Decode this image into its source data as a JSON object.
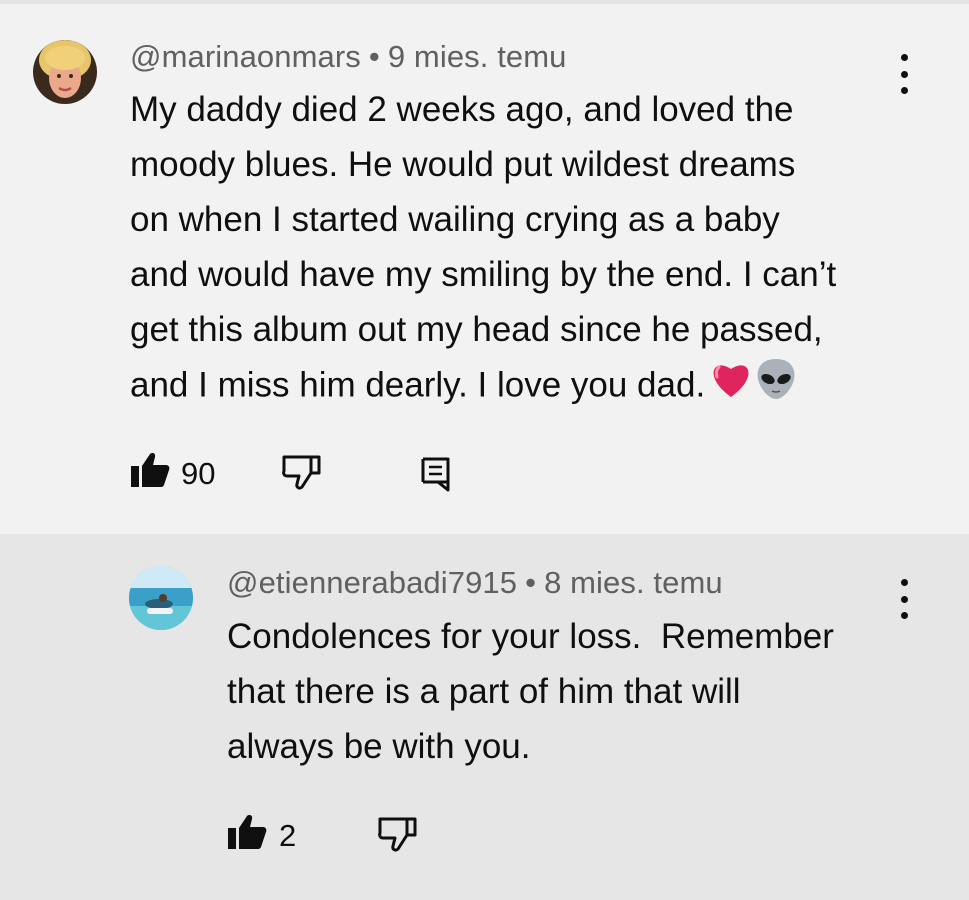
{
  "comment": {
    "username": "@marinaonmars",
    "separator": "•",
    "timestamp": "9 mies. temu",
    "text_lines": [
      "My daddy died 2 weeks ago, and loved the",
      "moody blues. He would put wildest dreams",
      "on when I started wailing crying as a baby",
      "and would have my smiling by the end. I can’t",
      "get this album out my head since he passed,",
      "and I miss him dearly. I love you dad."
    ],
    "emojis": [
      "heart-emoji",
      "alien-emoji"
    ],
    "likes": "90"
  },
  "reply": {
    "username": "@etiennerabadi7915",
    "separator": "•",
    "timestamp": "8 mies. temu",
    "text_lines": [
      "Condolences for your loss.  Remember",
      "that there is a part of him that will",
      "always be with you."
    ],
    "likes": "2"
  },
  "icons": {
    "like": "thumbs-up-icon",
    "dislike": "thumbs-down-icon",
    "reply": "reply-comment-icon",
    "menu": "more-vert-icon"
  },
  "colors": {
    "comment_bg": "#f2f2f2",
    "reply_bg": "#e6e6e6",
    "meta_text": "#606060",
    "body_text": "#0f0f0f",
    "heart": "#e0245e"
  }
}
